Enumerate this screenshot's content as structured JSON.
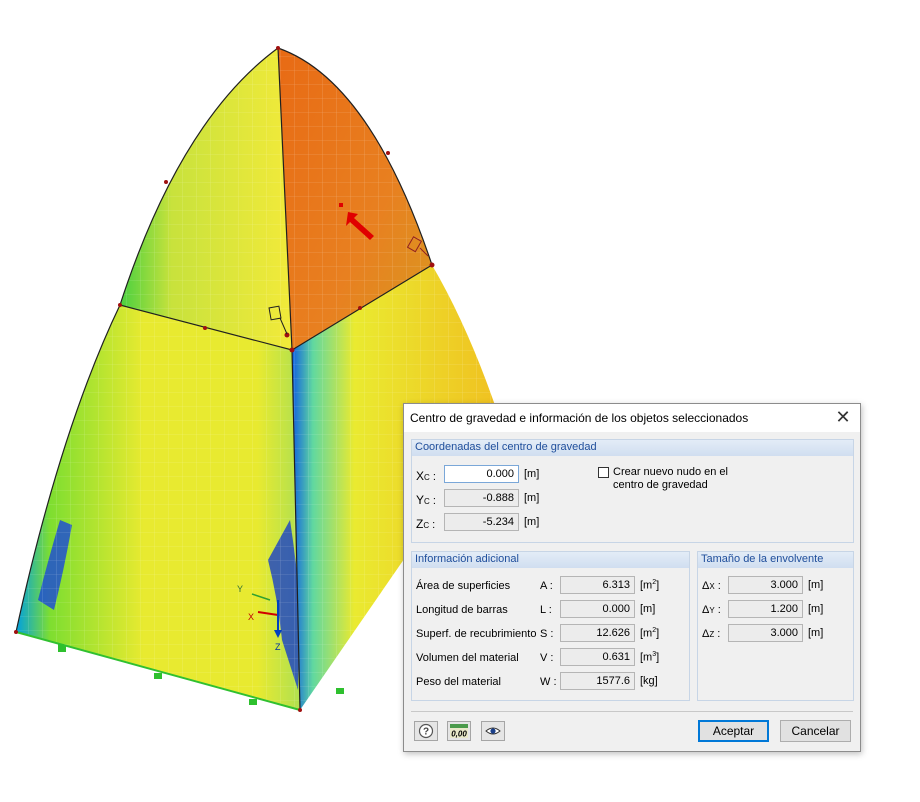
{
  "model_view": {
    "axis_labels": {
      "x": "X",
      "y": "Y",
      "z": "Z"
    }
  },
  "dialog": {
    "title": "Centro de gravedad e información de los objetos seleccionados",
    "coords_group": {
      "title": "Coordenadas del centro de gravedad",
      "rows": [
        {
          "letter": "X",
          "sub": "C",
          "value": "0.000",
          "unit": "[m]"
        },
        {
          "letter": "Y",
          "sub": "C",
          "value": "-0.888",
          "unit": "[m]"
        },
        {
          "letter": "Z",
          "sub": "C",
          "value": "-5.234",
          "unit": "[m]"
        }
      ],
      "checkbox_label_line1": "Crear nuevo nudo en el",
      "checkbox_label_line2": "centro de gravedad",
      "checkbox_checked": false
    },
    "info_group": {
      "title": "Información adicional",
      "rows": [
        {
          "label": "Área de superficies",
          "sym": "A :",
          "value": "6.313",
          "unit": "[m",
          "exp": "2",
          "unit_end": "]"
        },
        {
          "label": "Longitud de barras",
          "sym": "L :",
          "value": "0.000",
          "unit": "[m]",
          "exp": "",
          "unit_end": ""
        },
        {
          "label": "Superf. de recubrimiento",
          "sym": "S :",
          "value": "12.626",
          "unit": "[m",
          "exp": "2",
          "unit_end": "]"
        },
        {
          "label": "Volumen del material",
          "sym": "V :",
          "value": "0.631",
          "unit": "[m",
          "exp": "3",
          "unit_end": "]"
        },
        {
          "label": "Peso del material",
          "sym": "W :",
          "value": "1577.6",
          "unit": "[kg]",
          "exp": "",
          "unit_end": ""
        }
      ]
    },
    "envelope_group": {
      "title": "Tamaño de la envolvente",
      "rows": [
        {
          "sym": "Δ",
          "sub": "X",
          "value": "3.000",
          "unit": "[m]"
        },
        {
          "sym": "Δ",
          "sub": "Y",
          "value": "1.200",
          "unit": "[m]"
        },
        {
          "sym": "Δ",
          "sub": "Z",
          "value": "3.000",
          "unit": "[m]"
        }
      ]
    },
    "icon_buttons": [
      "help-icon",
      "decimal-places-icon",
      "view-icon"
    ],
    "decimal_icon_text": "0,00",
    "buttons": {
      "ok": "Aceptar",
      "cancel": "Cancelar"
    }
  },
  "colors": {
    "accent": "#0078d7",
    "group_title": "#1f4e9b",
    "highlight_surface": "#e07020",
    "arrow": "#e00000"
  }
}
